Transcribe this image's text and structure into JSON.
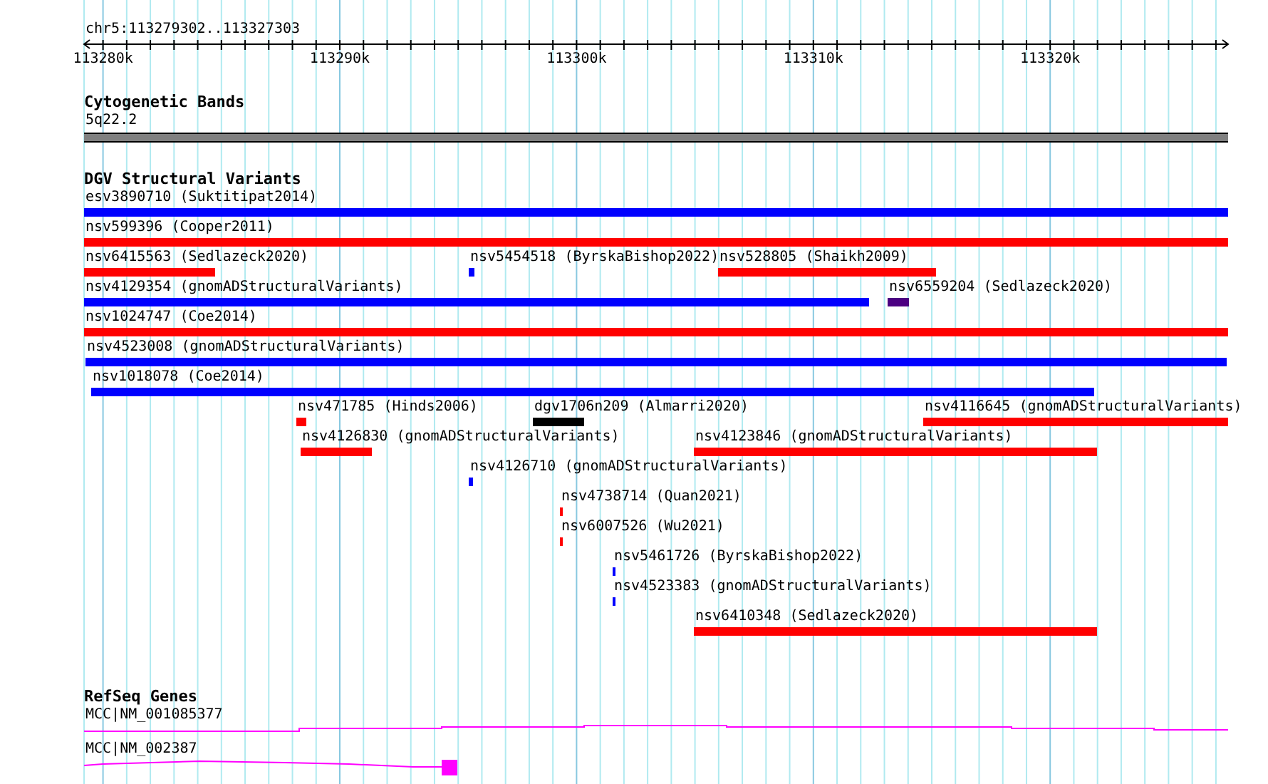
{
  "ruler": {
    "location": "chr5:113279302..113327303",
    "ticks": [
      "113280k",
      "113290k",
      "113300k",
      "113310k",
      "113320k"
    ]
  },
  "cytogenetic_bands": {
    "title": "Cytogenetic Bands",
    "band": "5q22.2"
  },
  "dgv_structural_variants": {
    "title": "DGV Structural Variants",
    "rows": [
      {
        "features": [
          {
            "label": "esv3890710 (Suktitipat2014)",
            "color": "#0000ff"
          }
        ]
      },
      {
        "features": [
          {
            "label": "nsv599396 (Cooper2011)",
            "color": "#ff0000"
          }
        ]
      },
      {
        "features": [
          {
            "label": "nsv6415563 (Sedlazeck2020)",
            "color": "#ff0000"
          },
          {
            "label": "nsv5454518 (ByrskaBishop2022)",
            "color": "#0000ff"
          },
          {
            "label": "nsv528805 (Shaikh2009)",
            "color": "#ff0000"
          }
        ]
      },
      {
        "features": [
          {
            "label": "nsv4129354 (gnomADStructuralVariants)",
            "color": "#0000ff"
          },
          {
            "label": "nsv6559204 (Sedlazeck2020)",
            "color": "#4b0082"
          }
        ]
      },
      {
        "features": [
          {
            "label": "nsv1024747 (Coe2014)",
            "color": "#ff0000"
          }
        ]
      },
      {
        "features": [
          {
            "label": "nsv4523008 (gnomADStructuralVariants)",
            "color": "#0000ff"
          }
        ]
      },
      {
        "features": [
          {
            "label": "nsv1018078 (Coe2014)",
            "color": "#0000ff"
          }
        ]
      },
      {
        "features": [
          {
            "label": "nsv471785 (Hinds2006)",
            "color": "#ff0000"
          },
          {
            "label": "dgv1706n209 (Almarri2020)",
            "color": "#000000"
          },
          {
            "label": "nsv4116645 (gnomADStructuralVariants)",
            "color": "#ff0000"
          }
        ]
      },
      {
        "features": [
          {
            "label": "nsv4126830 (gnomADStructuralVariants)",
            "color": "#ff0000"
          },
          {
            "label": "nsv4123846 (gnomADStructuralVariants)",
            "color": "#ff0000"
          }
        ]
      },
      {
        "features": [
          {
            "label": "nsv4126710 (gnomADStructuralVariants)",
            "color": "#0000ff"
          }
        ]
      },
      {
        "features": [
          {
            "label": "nsv4738714 (Quan2021)",
            "color": "#ff0000"
          }
        ]
      },
      {
        "features": [
          {
            "label": "nsv6007526 (Wu2021)",
            "color": "#ff0000"
          }
        ]
      },
      {
        "features": [
          {
            "label": "nsv5461726 (ByrskaBishop2022)",
            "color": "#0000ff"
          }
        ]
      },
      {
        "features": [
          {
            "label": "nsv4523383 (gnomADStructuralVariants)",
            "color": "#0000ff"
          }
        ]
      },
      {
        "features": [
          {
            "label": "nsv6410348 (Sedlazeck2020)",
            "color": "#ff0000"
          }
        ]
      }
    ]
  },
  "refseq_genes": {
    "title": "RefSeq Genes",
    "genes": [
      {
        "label": "MCC|NM_001085377"
      },
      {
        "label": "MCC|NM_002387"
      }
    ]
  }
}
